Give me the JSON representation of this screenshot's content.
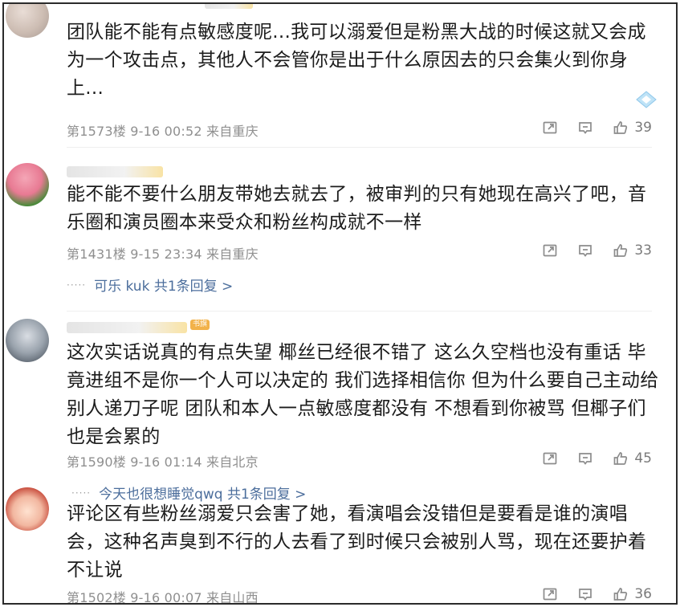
{
  "comments": [
    {
      "text": "团队能不能有点敏感度呢...我可以溺爱但是粉黑大战的时候这就又会成为一个攻击点，其他人不会管你是出于什么原因去的只会集火到你身上...",
      "floor": "第1573楼",
      "time": "9-16 00:52",
      "location": "来自重庆",
      "likes": "39"
    },
    {
      "text": "能不能不要什么朋友带她去就去了，被审判的只有她现在高兴了吧，音乐圈和演员圈本来受众和粉丝构成就不一样",
      "floor": "第1431楼",
      "time": "9-15 23:34",
      "location": "来自重庆",
      "likes": "33",
      "replies": "可乐 kuk  共1条回复 >"
    },
    {
      "text": "这次实话说真的有点失望 椰丝已经很不错了 这么久空档也没有重话 毕竟进组不是你一个人可以决定的 我们选择相信你 但为什么要自己主动给别人递刀子呢 团队和本人一点敏感度都没有 不想看到你被骂 但椰子们也是会累的",
      "floor": "第1590楼",
      "time": "9-16 01:14",
      "location": "来自北京",
      "likes": "45",
      "replies": "今天也很想睡觉qwq  共1条回复 >"
    },
    {
      "text": "评论区有些粉丝溺爱只会害了她，看演唱会没错但是要看是谁的演唱会，这种名声臭到不行的人去看了到时候只会被别人骂，现在还要护着不让说",
      "floor": "第1502楼",
      "time": "9-16 00:07",
      "location": "来自山西",
      "likes": "36"
    }
  ],
  "icons": {
    "share": "share-icon",
    "comment": "comment-icon",
    "like": "thumbs-up-icon"
  },
  "badge_text": "书旗",
  "colors": {
    "reply_link": "#4c6e9c",
    "meta": "#8f8f8f"
  }
}
